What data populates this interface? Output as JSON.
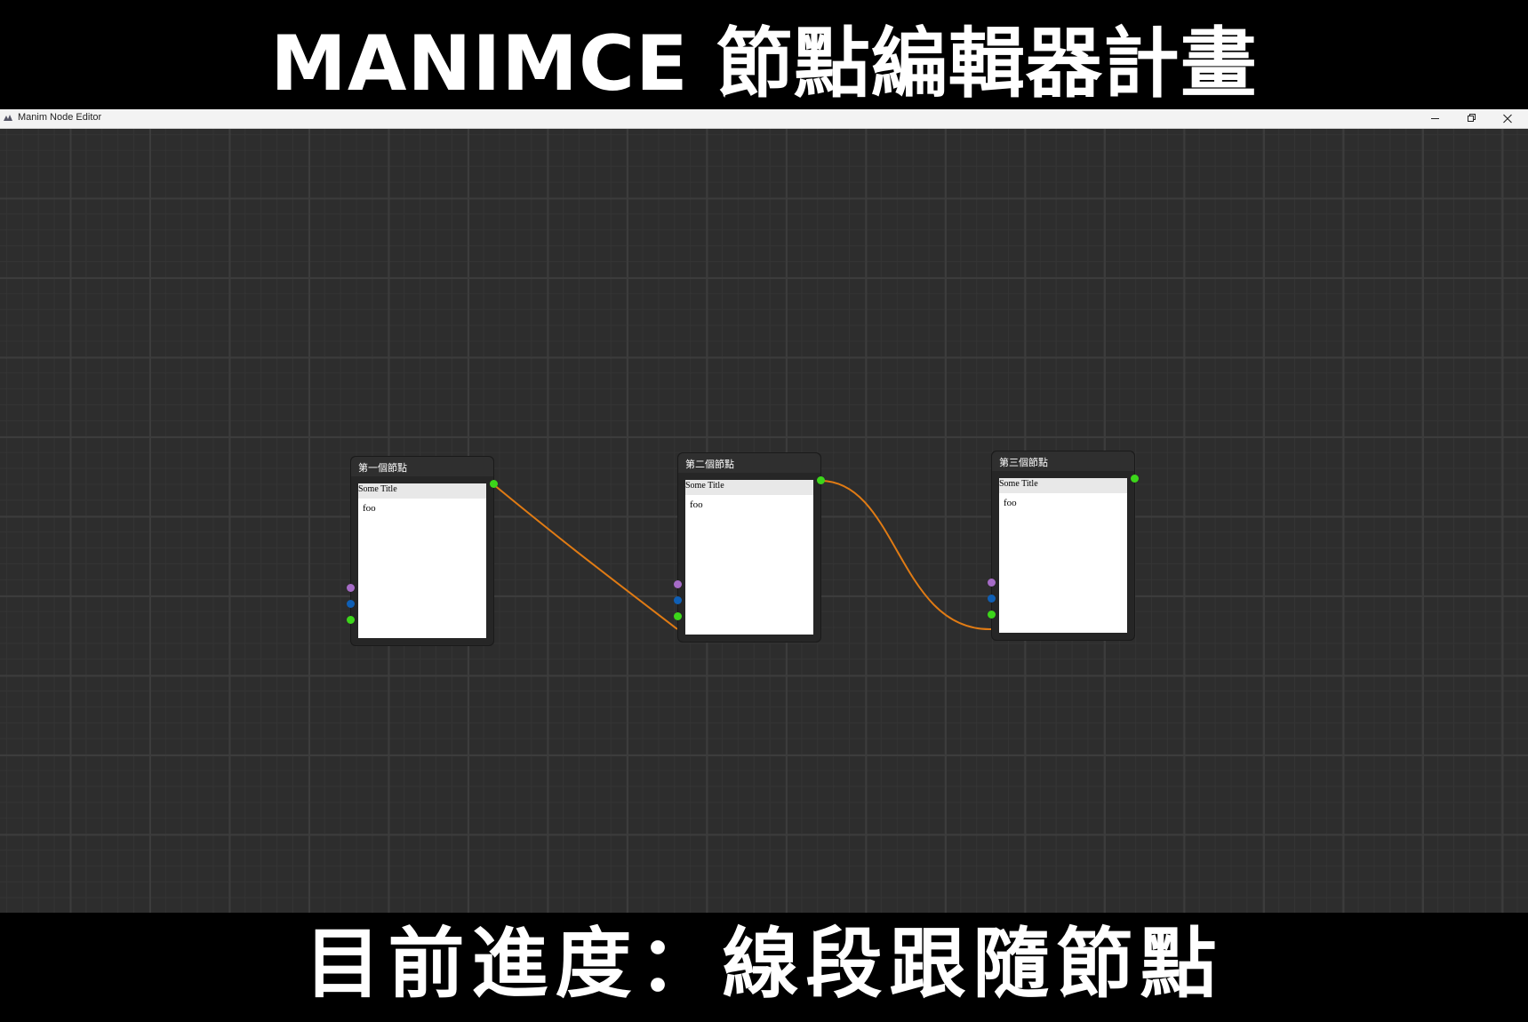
{
  "headline_top": "MANIMCE 節點編輯器計畫",
  "headline_bottom": "目前進度：線段跟隨節點",
  "window": {
    "title": "Manim Node Editor",
    "app_icon": "app-icon",
    "controls": [
      "minimize-icon",
      "restore-icon",
      "close-icon"
    ]
  },
  "nodes": [
    {
      "title": "第一個節點",
      "body_title": "Some Title",
      "body_text": "foo"
    },
    {
      "title": "第二個節點",
      "body_title": "Some Title",
      "body_text": "foo"
    },
    {
      "title": "第三個節點",
      "body_title": "Some Title",
      "body_text": "foo"
    }
  ],
  "colors": {
    "canvas_bg": "#2d2d2d",
    "link": "#e07b14",
    "port_output": "#3cd61a",
    "port_purple": "#a56bc6",
    "port_blue": "#0f5fb5"
  }
}
